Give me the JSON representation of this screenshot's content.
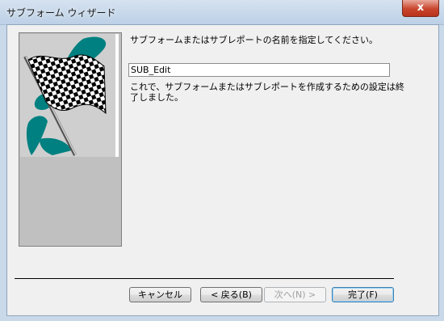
{
  "window": {
    "title": "サブフォーム ウィザード",
    "close_glyph": "x"
  },
  "main": {
    "instruction": "サブフォームまたはサブレポートの名前を指定してください。",
    "name_value": "SUB_Edit",
    "completion_text": "これで、サブフォームまたはサブレポートを作成するための設定は終了しました。"
  },
  "image": {
    "icon": "checkered-flag-icon",
    "colors": {
      "background": "#c0c0c0",
      "accent": "#008080",
      "panel": "#cfcfcf"
    }
  },
  "buttons": {
    "cancel": "キャンセル",
    "back": "< 戻る(B)",
    "next": "次へ(N) >",
    "finish": "完了(F)"
  }
}
